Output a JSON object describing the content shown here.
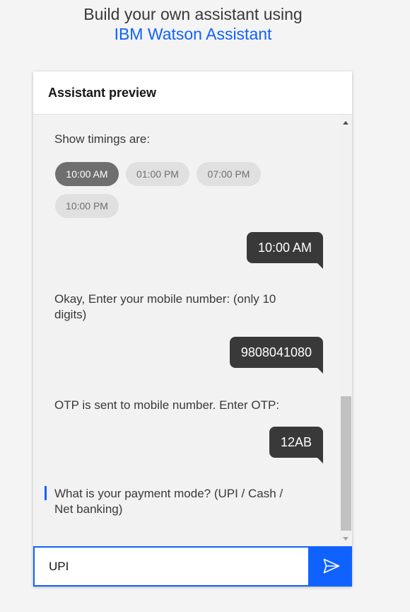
{
  "header": {
    "line1": "Build your own assistant using",
    "line2": "IBM Watson Assistant"
  },
  "panel": {
    "title": "Assistant preview"
  },
  "chat": {
    "prompt1": "Show timings are:",
    "options": [
      "10:00 AM",
      "01:00 PM",
      "07:00 PM",
      "10:00 PM"
    ],
    "selected_option": "10:00 AM",
    "user_reply1": "10:00 AM",
    "prompt2": "Okay, Enter your mobile number: (only 10 digits)",
    "user_reply2": "9808041080",
    "prompt3": "OTP is sent to mobile number. Enter OTP:",
    "user_reply3": "12AB",
    "prompt4": "What is your payment mode? (UPI / Cash / Net banking)"
  },
  "input": {
    "value": "UPI",
    "placeholder": ""
  },
  "icons": {
    "send": "send-icon"
  },
  "colors": {
    "accent": "#0f62fe",
    "user_bubble": "#393939",
    "chip": "#e0e0e0",
    "chip_selected": "#6f6f6f"
  }
}
